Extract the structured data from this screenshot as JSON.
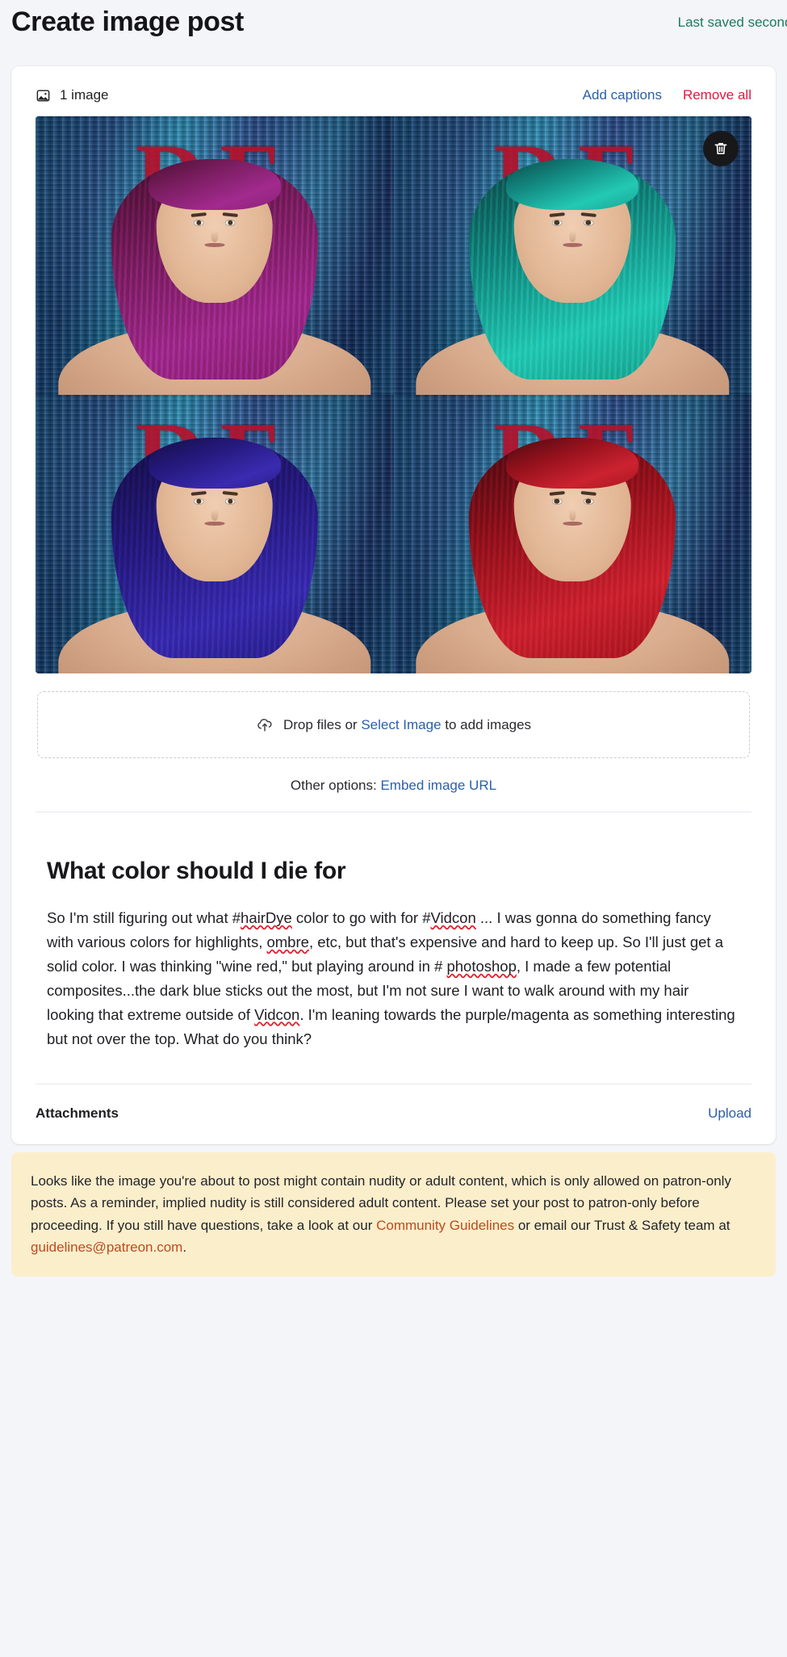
{
  "header": {
    "title": "Create image post",
    "last_saved": "Last saved seconds ago"
  },
  "media": {
    "count_label": "1 image",
    "image_icon": "image-icon",
    "add_captions_label": "Add captions",
    "remove_all_label": "Remove all",
    "delete_icon": "trash-icon",
    "photo_alt": "Four-panel composite of the same portrait with purple, teal, dark blue, and red hair",
    "backdrop_letters": "DF"
  },
  "dropzone": {
    "upload_icon": "cloud-upload-icon",
    "prefix": "Drop files or ",
    "link": "Select Image",
    "suffix": " to add images"
  },
  "other_options": {
    "label": "Other options: ",
    "link": "Embed image URL"
  },
  "post": {
    "title": "What color should I die for",
    "body_parts": [
      {
        "t": "So I'm still figuring out what #"
      },
      {
        "t": "hairDye",
        "sp": true
      },
      {
        "t": " color to go with for #"
      },
      {
        "t": "Vidcon",
        "sp": true
      },
      {
        "t": " ...  I was gonna do something fancy with various colors for highlights,  "
      },
      {
        "t": "ombre",
        "sp": true
      },
      {
        "t": ", etc, but that's expensive and hard to keep up. So I'll just get a  solid color. I was thinking \"wine red,\" but playing around in # "
      },
      {
        "t": "photoshop",
        "sp": true
      },
      {
        "t": ",  I made a few potential composites...the dark blue sticks out the most,  but I'm not sure I want to walk around with my hair looking that extreme  outside of "
      },
      {
        "t": "Vidcon",
        "sp": true
      },
      {
        "t": ". I'm leaning towards the purple/magenta as something  interesting but not over the top. What do you think?"
      }
    ]
  },
  "attachments": {
    "label": "Attachments",
    "upload_label": "Upload"
  },
  "notice": {
    "parts": [
      {
        "t": "Looks like the image you're about to post might contain nudity or adult content, which is only allowed on patron-only posts. As a reminder, implied nudity is still considered adult content. Please set your post to patron-only before proceeding. If you still have questions, take a look at our "
      },
      {
        "t": "Community Guidelines",
        "link": true
      },
      {
        "t": " or email our Trust & Safety team at "
      },
      {
        "t": "guidelines@patreon.com",
        "link": true
      },
      {
        "t": "."
      }
    ]
  },
  "colors": {
    "page_background": "#f4f5f9",
    "card_background": "#ffffff",
    "link_blue": "#2b5faa",
    "link_red": "#e0193f",
    "saved_green": "#1d7a5f",
    "notice_background": "#fbeecb",
    "notice_link": "#bf4a1f",
    "spellcheck_underline": "#e0202b"
  }
}
